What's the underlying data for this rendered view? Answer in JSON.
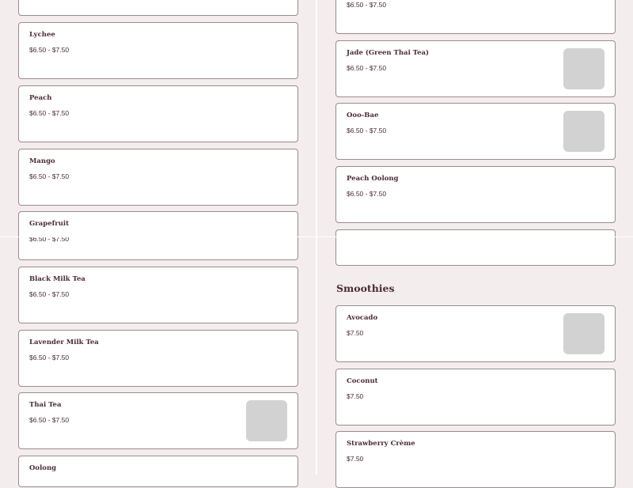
{
  "left_column": [
    {
      "name": "",
      "price": ""
    },
    {
      "name": "Lychee",
      "price": "$6.50 - $7.50"
    },
    {
      "name": "Peach",
      "price": "$6.50 - $7.50"
    },
    {
      "name": "Mango",
      "price": "$6.50 - $7.50"
    },
    {
      "name": "Grapefruit",
      "price": "$6.50 - $7.50"
    },
    {
      "name": "Black Milk Tea",
      "price": "$6.50 - $7.50"
    },
    {
      "name": "Lavender Milk Tea",
      "price": "$6.50 - $7.50"
    },
    {
      "name": "Thai Tea",
      "price": "$6.50 - $7.50",
      "image": "item-photo-placeholder"
    },
    {
      "name": "Oolong",
      "price": ""
    }
  ],
  "right_column": [
    {
      "name": "",
      "price": "$6.50 - $7.50"
    },
    {
      "name": "Jade (Green Thai Tea)",
      "price": "$6.50 - $7.50",
      "image": "item-photo-placeholder"
    },
    {
      "name": "Ooo-Bae",
      "price": "$6.50 - $7.50",
      "image": "item-photo-placeholder"
    },
    {
      "name": "Peach Oolong",
      "price": "$6.50 - $7.50"
    },
    {
      "name": "",
      "price": ""
    }
  ],
  "smoothies": {
    "heading": "Smoothies",
    "items": [
      {
        "name": "Avocado",
        "price": "$7.50",
        "image": "item-photo-placeholder"
      },
      {
        "name": "Coconut",
        "price": "$7.50"
      },
      {
        "name": "Strawberry Crème",
        "price": "$7.50"
      }
    ]
  },
  "colors": {
    "background": "#f3eded",
    "text": "#4a2a33",
    "border": "#9c8a90",
    "placeholder": "#d2d2d2"
  }
}
